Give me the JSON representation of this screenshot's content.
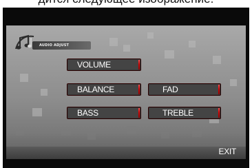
{
  "caption": "дится следующее изображение.",
  "header": {
    "title": "AUDIO ADJUST",
    "icon": "music-notes-icon"
  },
  "menu": {
    "volume_label": "VOLUME",
    "balance_label": "BALANCE",
    "fad_label": "FAD",
    "bass_label": "BASS",
    "treble_label": "TREBLE"
  },
  "footer": {
    "exit_label": "EXIT"
  },
  "colors": {
    "button_accent": "#d80000",
    "panel": "#9a9a9a",
    "frame": "#0a0a0a"
  }
}
